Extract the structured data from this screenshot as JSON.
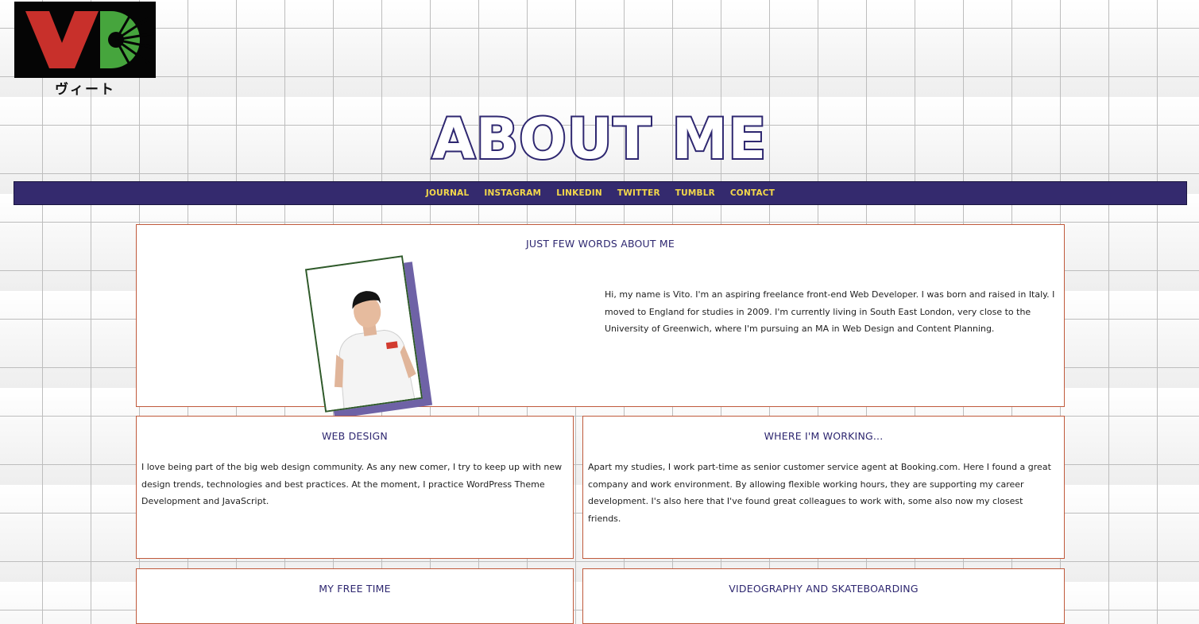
{
  "logo": {
    "letters": "VD",
    "subtitle": "ヴィート",
    "colors": {
      "v": "#c8302b",
      "d": "#46a53d",
      "background": "#050505"
    }
  },
  "page_title": "ABOUT ME",
  "nav": {
    "items": [
      "JOURNAL",
      "INSTAGRAM",
      "LINKEDIN",
      "TWITTER",
      "TUMBLR",
      "CONTACT"
    ]
  },
  "intro": {
    "title": "JUST FEW WORDS ABOUT ME",
    "text": "Hi, my name is Vito. I'm an aspiring freelance front-end Web Developer. I was born and raised in Italy. I moved to England for studies in 2009. I'm currently living in South East London, very close to the University of Greenwich, where I'm pursuing an MA in Web Design and Content Planning."
  },
  "web_design": {
    "title": "WEB DESIGN",
    "text": "I love being part of the big web design community. As any new comer, I try to keep up with new design trends, technologies and best practices. At the moment, I practice WordPress Theme Development and JavaScript."
  },
  "working": {
    "title": "WHERE I'M WORKING...",
    "text": "Apart my studies, I work part-time as senior customer service agent at Booking.com. Here I found a great company and work environment. By allowing flexible working hours, they are supporting my career development. I's also here that I've found great colleagues to work with, some also now my closest friends."
  },
  "free_time": {
    "title": "MY FREE TIME"
  },
  "videography": {
    "title": "VIDEOGRAPHY AND SKATEBOARDING"
  },
  "colors": {
    "nav_bg": "#342a6e",
    "nav_text": "#f3d84a",
    "title": "#2e2770",
    "card_border": "#c05a3c"
  }
}
